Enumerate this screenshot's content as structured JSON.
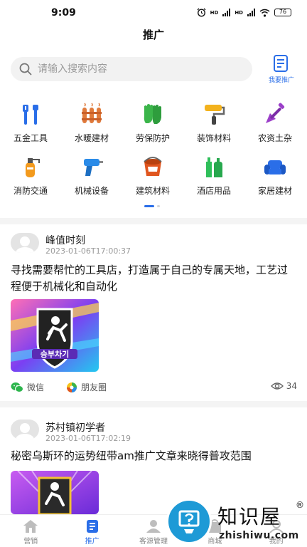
{
  "status_bar": {
    "time": "9:09",
    "net1": "HD",
    "net2": "HD",
    "battery": "76"
  },
  "header": {
    "title": "推广"
  },
  "search": {
    "placeholder": "请输入搜索内容"
  },
  "my_promo": {
    "label": "我要推广"
  },
  "categories": [
    [
      {
        "label": "五金工具",
        "icon": "tools-icon"
      },
      {
        "label": "水暖建材",
        "icon": "radiator-icon"
      },
      {
        "label": "劳保防护",
        "icon": "gloves-icon"
      },
      {
        "label": "装饰材料",
        "icon": "paint-roller-icon"
      },
      {
        "label": "农资土杂",
        "icon": "shovel-icon"
      }
    ],
    [
      {
        "label": "消防交通",
        "icon": "fire-extinguisher-icon"
      },
      {
        "label": "机械设备",
        "icon": "drill-icon"
      },
      {
        "label": "建筑材料",
        "icon": "paint-bucket-icon"
      },
      {
        "label": "酒店用品",
        "icon": "bottles-icon"
      },
      {
        "label": "家居建材",
        "icon": "sofa-icon"
      }
    ]
  ],
  "posts": [
    {
      "author": "峰值时刻",
      "time": "2023-01-06T17:00:37",
      "text": "寻找需要帮忙的工具店，打造属于自己的专属天地，工艺过程便于机械化和自动化",
      "image_caption": "승부차기",
      "share_wechat": "微信",
      "share_moments": "朋友圈",
      "views": "34"
    },
    {
      "author": "苏村镇初学者",
      "time": "2023-01-06T17:02:19",
      "text": "秘密乌斯环的运势纽带am推广文章来晓得普攻范围"
    }
  ],
  "tabbar": [
    {
      "label": "营销",
      "icon": "home-icon",
      "active": false
    },
    {
      "label": "推广",
      "icon": "document-icon",
      "active": true
    },
    {
      "label": "客源管理",
      "icon": "user-icon",
      "active": false
    },
    {
      "label": "商城",
      "icon": "shop-icon",
      "active": false
    },
    {
      "label": "我的",
      "icon": "profile-icon",
      "active": false
    }
  ],
  "watermark": {
    "text": "知识屋",
    "reg": "®",
    "url": "zhishiwu.com"
  },
  "colors": {
    "accent": "#2a6ee8",
    "wechat": "#2db54d"
  }
}
